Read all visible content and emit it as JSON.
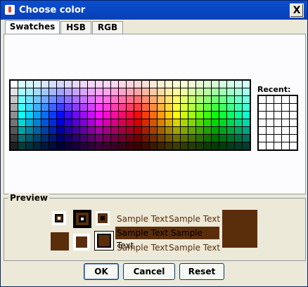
{
  "window": {
    "title": "Choose color",
    "close": "X"
  },
  "tabs": [
    {
      "label": "Swatches",
      "key": "S",
      "rest": "watches"
    },
    {
      "label": "HSB",
      "key": "H",
      "rest": "SB"
    },
    {
      "label": "RGB",
      "key": "",
      "rest": ""
    }
  ],
  "swatches": {
    "recent_label": "Recent:"
  },
  "preview": {
    "label": "Preview",
    "sample_text": "Sample Text",
    "color": "#5a2e0a"
  },
  "buttons": {
    "ok": "OK",
    "cancel": "Cancel",
    "reset": "Reset"
  }
}
